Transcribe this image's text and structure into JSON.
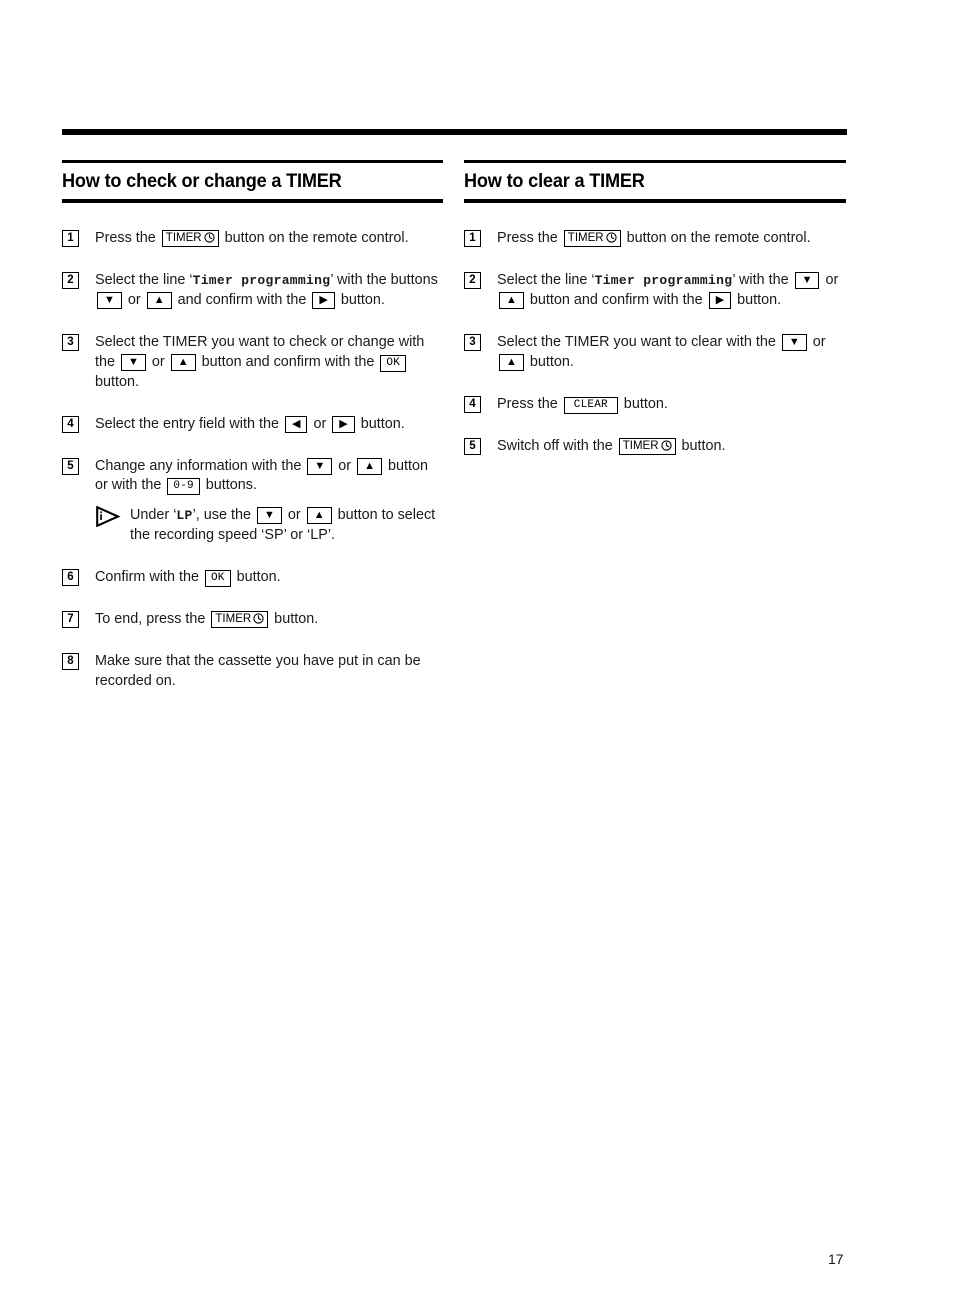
{
  "document": {
    "page_number": "17"
  },
  "columns": [
    {
      "id": "check-or-change",
      "title": "How to check or change a TIMER",
      "steps": [
        {
          "number": "1",
          "parts": [
            {
              "t": "text",
              "v": "Press the "
            },
            {
              "t": "key-timer",
              "v": "TIMER"
            },
            {
              "t": "text",
              "v": " button on the remote control."
            }
          ]
        },
        {
          "number": "2",
          "parts": [
            {
              "t": "text",
              "v": "Select the line ‘"
            },
            {
              "t": "lit",
              "v": "Timer programming"
            },
            {
              "t": "text",
              "v": "’ with the buttons "
            },
            {
              "t": "key-down",
              "v": "▼"
            },
            {
              "t": "text",
              "v": " or "
            },
            {
              "t": "key-up",
              "v": "▲"
            },
            {
              "t": "text",
              "v": " and confirm with the "
            },
            {
              "t": "key-right",
              "v": "▶"
            },
            {
              "t": "text",
              "v": " button."
            }
          ]
        },
        {
          "number": "3",
          "parts": [
            {
              "t": "text",
              "v": "Select the TIMER you want to check or change with the "
            },
            {
              "t": "key-down",
              "v": "▼"
            },
            {
              "t": "text",
              "v": " or "
            },
            {
              "t": "key-up",
              "v": "▲"
            },
            {
              "t": "text",
              "v": " button and confirm with the "
            },
            {
              "t": "key-mono",
              "v": "OK"
            },
            {
              "t": "text",
              "v": " button."
            }
          ]
        },
        {
          "number": "4",
          "parts": [
            {
              "t": "text",
              "v": "Select the entry field with the "
            },
            {
              "t": "key-left",
              "v": "◀"
            },
            {
              "t": "text",
              "v": " or "
            },
            {
              "t": "key-right",
              "v": "▶"
            },
            {
              "t": "text",
              "v": " button."
            }
          ]
        },
        {
          "number": "5",
          "parts": [
            {
              "t": "text",
              "v": "Change any information with the "
            },
            {
              "t": "key-down",
              "v": "▼"
            },
            {
              "t": "text",
              "v": " or "
            },
            {
              "t": "key-up",
              "v": "▲"
            },
            {
              "t": "text",
              "v": " button or with the "
            },
            {
              "t": "key-mono",
              "v": "0-9"
            },
            {
              "t": "text",
              "v": " buttons."
            }
          ],
          "tip": {
            "parts": [
              {
                "t": "text",
                "v": "Under ‘"
              },
              {
                "t": "lit",
                "v": "LP"
              },
              {
                "t": "text",
                "v": "’, use the "
              },
              {
                "t": "key-down",
                "v": "▼"
              },
              {
                "t": "text",
                "v": " or "
              },
              {
                "t": "key-up",
                "v": "▲"
              },
              {
                "t": "text",
                "v": " button to select the recording speed ‘SP’ or ‘LP’."
              }
            ]
          }
        },
        {
          "number": "6",
          "parts": [
            {
              "t": "text",
              "v": "Confirm with the "
            },
            {
              "t": "key-mono",
              "v": "OK"
            },
            {
              "t": "text",
              "v": " button."
            }
          ]
        },
        {
          "number": "7",
          "parts": [
            {
              "t": "text",
              "v": "To end, press the "
            },
            {
              "t": "key-timer",
              "v": "TIMER"
            },
            {
              "t": "text",
              "v": " button."
            }
          ]
        },
        {
          "number": "8",
          "parts": [
            {
              "t": "text",
              "v": "Make sure that the cassette you have put in can be recorded on."
            }
          ]
        }
      ]
    },
    {
      "id": "clear",
      "title": "How to clear a TIMER",
      "steps": [
        {
          "number": "1",
          "parts": [
            {
              "t": "text",
              "v": "Press the "
            },
            {
              "t": "key-timer",
              "v": "TIMER"
            },
            {
              "t": "text",
              "v": " button on the remote control."
            }
          ]
        },
        {
          "number": "2",
          "parts": [
            {
              "t": "text",
              "v": "Select the line ‘"
            },
            {
              "t": "lit",
              "v": "Timer programming"
            },
            {
              "t": "text",
              "v": "’ with the "
            },
            {
              "t": "key-down",
              "v": "▼"
            },
            {
              "t": "text",
              "v": " or "
            },
            {
              "t": "key-up",
              "v": "▲"
            },
            {
              "t": "text",
              "v": " button and confirm with the "
            },
            {
              "t": "key-right",
              "v": "▶"
            },
            {
              "t": "text",
              "v": " button."
            }
          ]
        },
        {
          "number": "3",
          "parts": [
            {
              "t": "text",
              "v": "Select the TIMER you want to clear with the "
            },
            {
              "t": "key-down",
              "v": "▼"
            },
            {
              "t": "text",
              "v": " or "
            },
            {
              "t": "key-up",
              "v": "▲"
            },
            {
              "t": "text",
              "v": " button."
            }
          ]
        },
        {
          "number": "4",
          "parts": [
            {
              "t": "text",
              "v": "Press the "
            },
            {
              "t": "key-mono-wide",
              "v": "CLEAR"
            },
            {
              "t": "text",
              "v": " button."
            }
          ]
        },
        {
          "number": "5",
          "parts": [
            {
              "t": "text",
              "v": "Switch off with the "
            },
            {
              "t": "key-timer",
              "v": "TIMER"
            },
            {
              "t": "text",
              "v": " button."
            }
          ]
        }
      ]
    }
  ]
}
